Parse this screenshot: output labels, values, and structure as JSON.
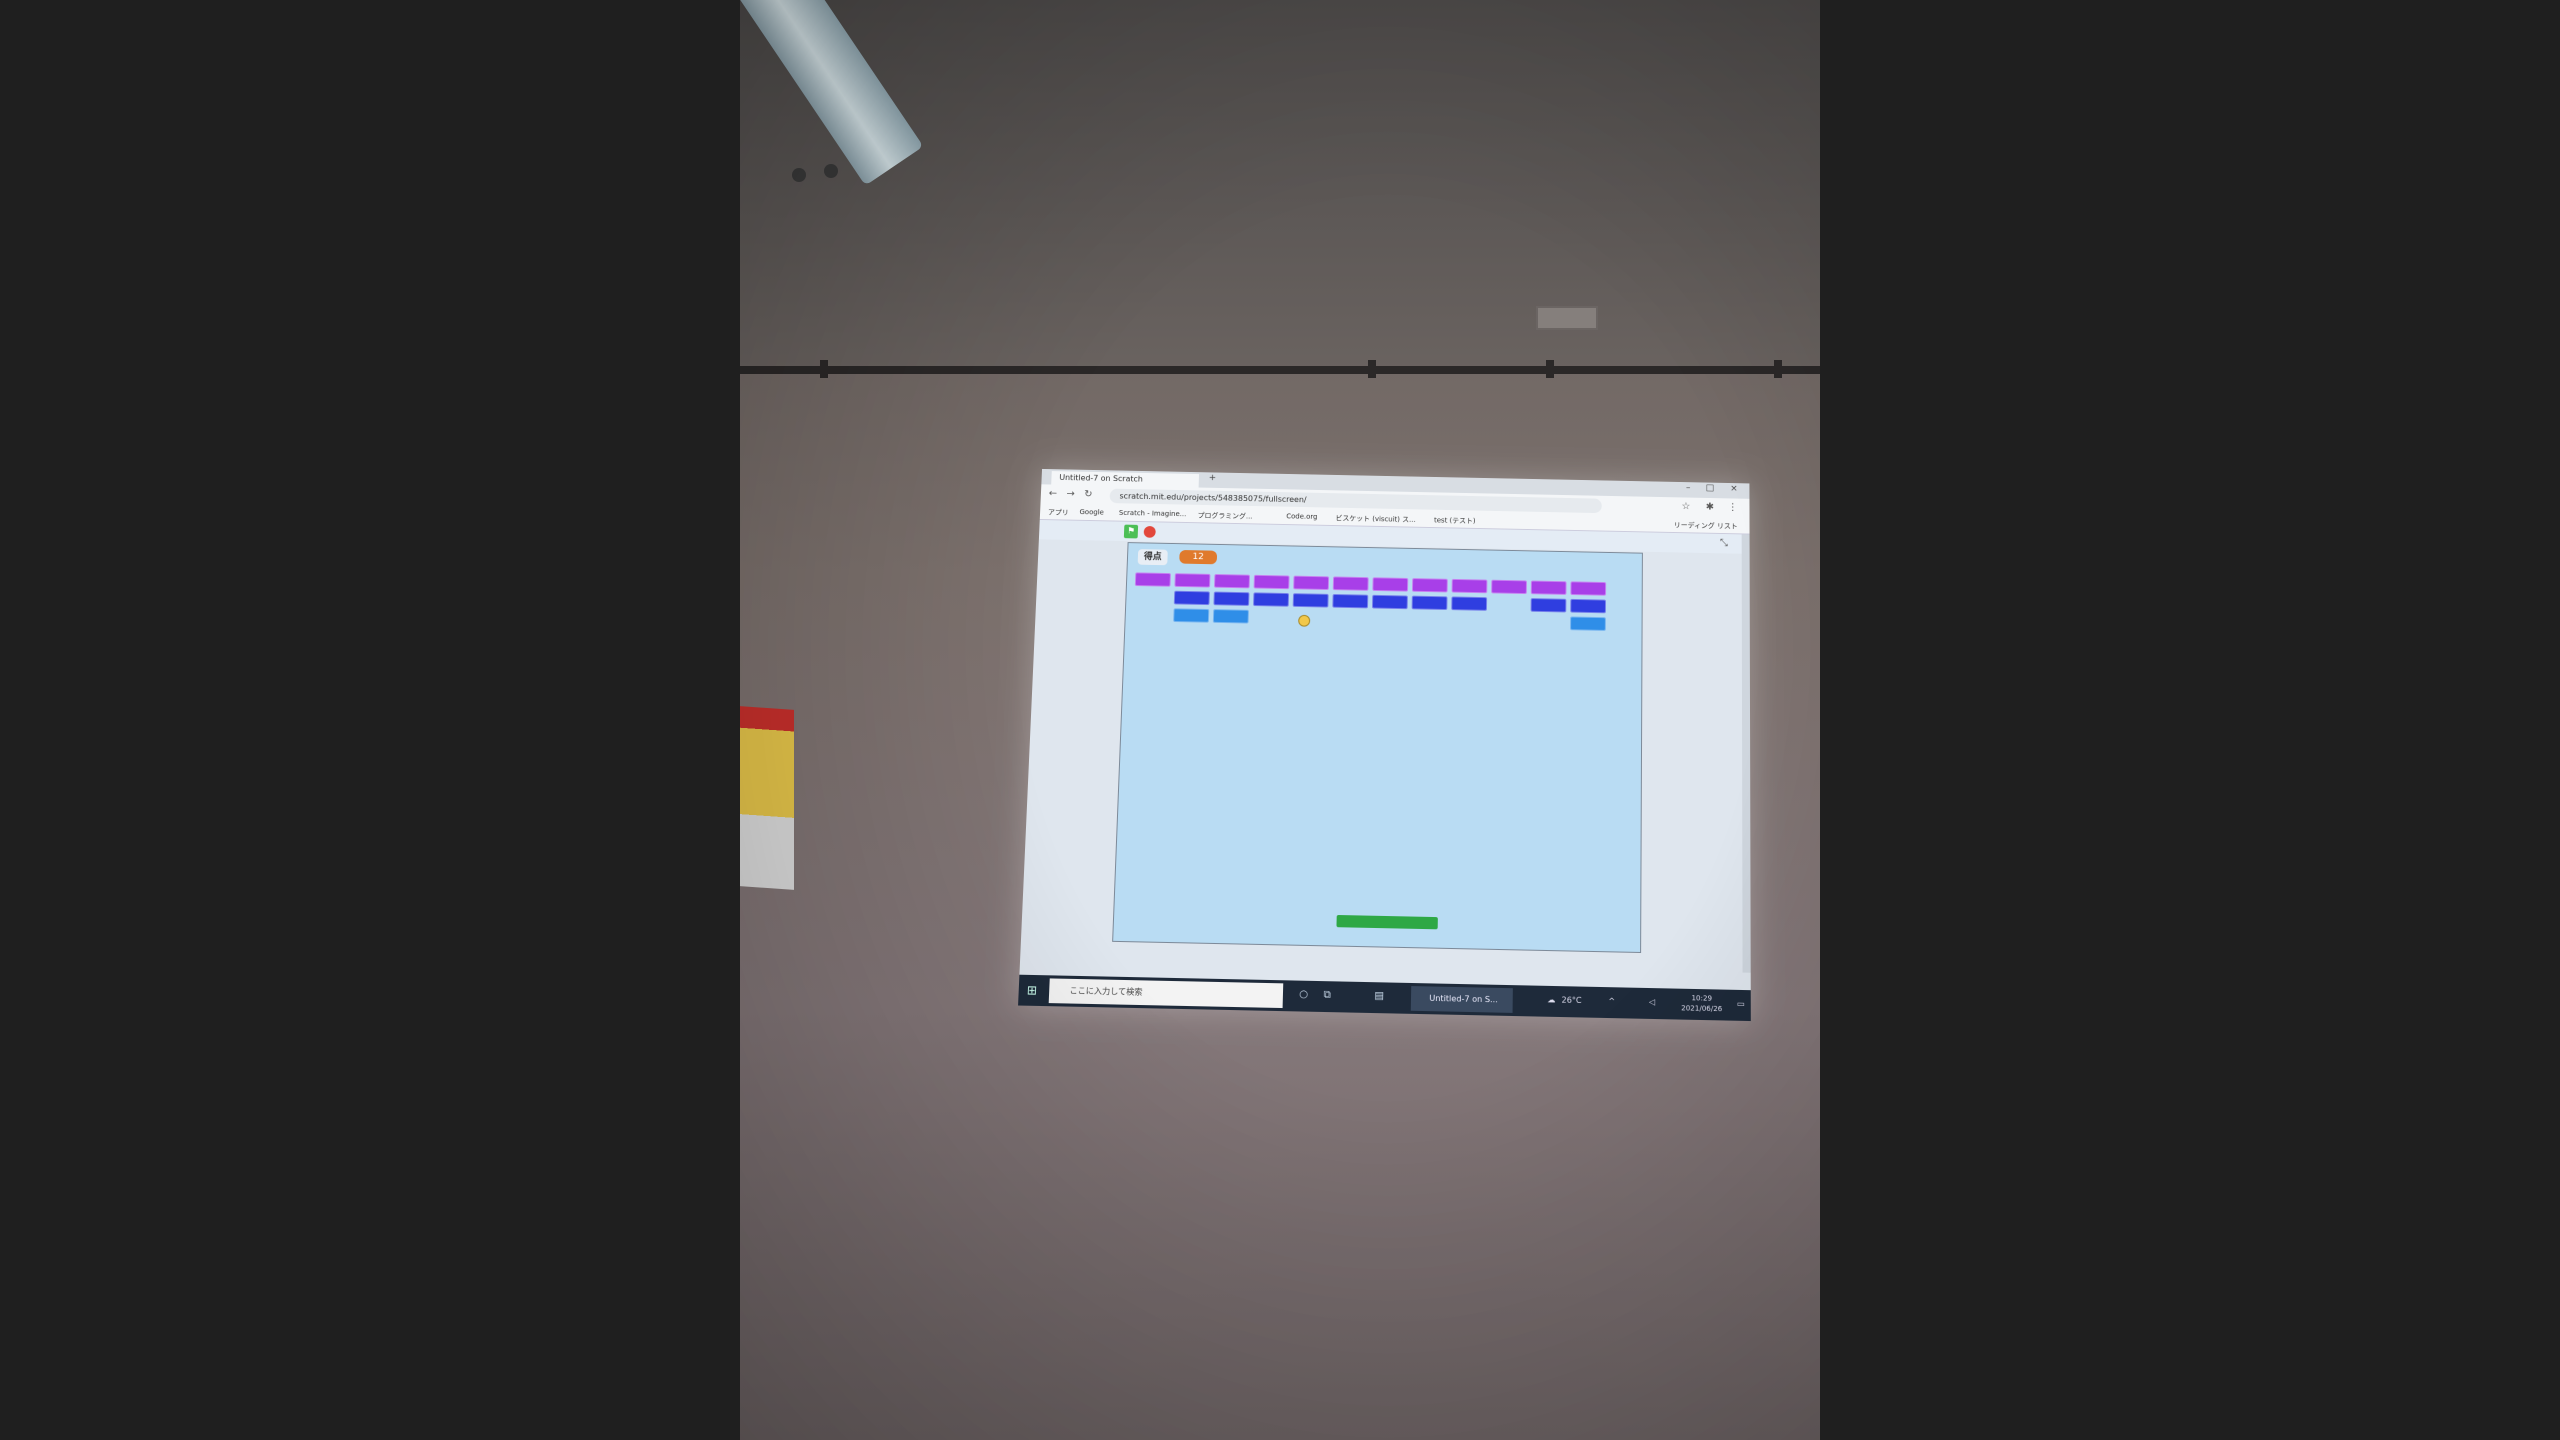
{
  "browser": {
    "tab_title": "Untitled-7 on Scratch",
    "url": "scratch.mit.edu/projects/548385075/fullscreen/",
    "bookmarks": [
      "アプリ",
      "Google",
      "Scratch - Imagine...",
      "プログラミング...",
      "Code.org",
      "ビスケット (viscuit) ス...",
      "test (テスト)",
      "リーディング リスト"
    ]
  },
  "scratch": {
    "flag_icon": "green-flag-icon",
    "stop_icon": "stop-icon",
    "score_label": "得点",
    "score_value": "12"
  },
  "taskbar": {
    "search_placeholder": "ここに入力して検索",
    "active_window": "Untitled-7 on S...",
    "weather": "26°C",
    "time": "10:29",
    "date": "2021/06/26"
  },
  "colors": {
    "brick_row1": "#a83fe8",
    "brick_row2": "#2f3ee0",
    "brick_row3": "#2f8ee8",
    "paddle": "#2ea845",
    "stage_bg": "#b9dcf3"
  }
}
